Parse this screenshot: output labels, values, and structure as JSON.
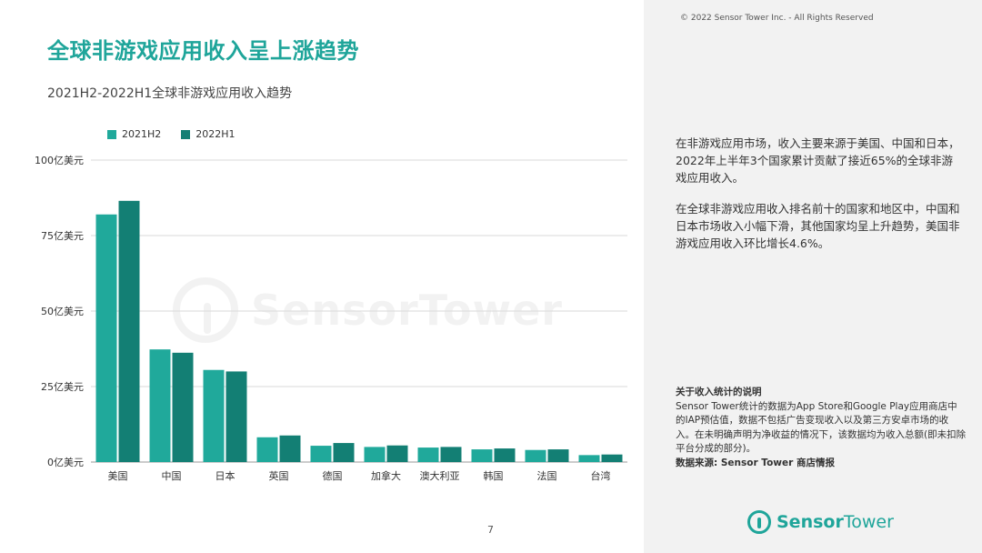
{
  "page": {
    "title": "全球非游戏应用收入呈上涨趋势",
    "page_number": "7",
    "copyright": "© 2022 Sensor Tower Inc. - All Rights Reserved",
    "watermark": "SensorTower"
  },
  "colors": {
    "accent": "#1fa59a",
    "series1": "#20a99b",
    "series2": "#137f74"
  },
  "sidebar": {
    "para1": "在非游戏应用市场，收入主要来源于美国、中国和日本，2022年上半年3个国家累计贡献了接近65%的全球非游戏应用收入。",
    "para2": "在全球非游戏应用收入排名前十的国家和地区中，中国和日本市场收入小幅下滑，其他国家均呈上升趋势，美国非游戏应用收入环比增长4.6%。",
    "notes_heading": "关于收入统计的说明",
    "notes_body": "Sensor Tower统计的数据为App Store和Google Play应用商店中的IAP预估值，数据不包括广告变现收入以及第三方安卓市场的收入。在未明确声明为净收益的情况下，该数据均为收入总额(即未扣除平台分成的部分)。",
    "source": "数据来源: Sensor Tower 商店情报"
  },
  "logo": {
    "part1": "Sensor",
    "part2": "Tower"
  },
  "chart_data": {
    "type": "bar",
    "title": "2021H2-2022H1全球非游戏应用收入趋势",
    "categories": [
      "美国",
      "中国",
      "日本",
      "英国",
      "德国",
      "加拿大",
      "澳大利亚",
      "韩国",
      "法国",
      "台湾"
    ],
    "series": [
      {
        "name": "2021H2",
        "values": [
          82,
          37.3,
          30.5,
          8.2,
          5.4,
          5.0,
          4.8,
          4.2,
          4.0,
          2.3
        ]
      },
      {
        "name": "2022H1",
        "values": [
          86.5,
          36.2,
          30.0,
          8.8,
          6.3,
          5.5,
          5.0,
          4.5,
          4.2,
          2.5
        ]
      }
    ],
    "ylim": [
      0,
      100
    ],
    "yticks": [
      0,
      25,
      50,
      75,
      100
    ],
    "ytick_labels": [
      "0亿美元",
      "25亿美元",
      "50亿美元",
      "75亿美元",
      "100亿美元"
    ],
    "grid": true,
    "legend_position": "top-left"
  }
}
